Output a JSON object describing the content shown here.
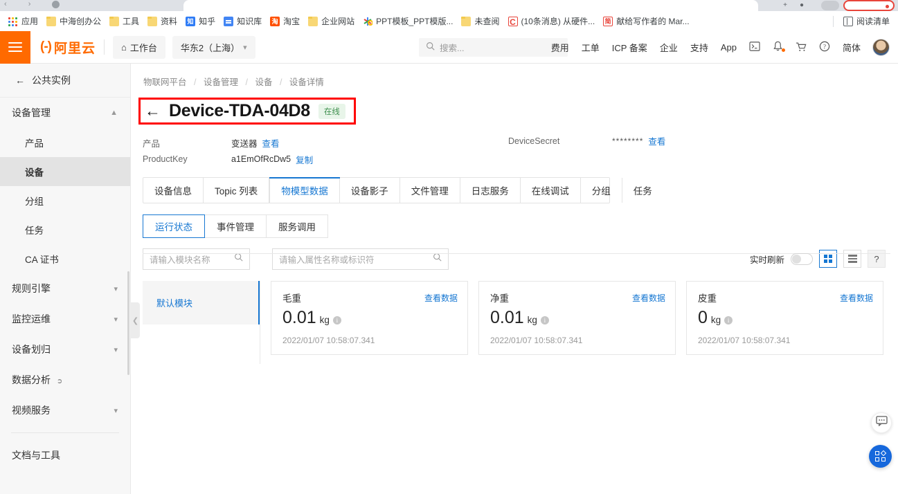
{
  "browser": {
    "bookmarks": [
      {
        "label": "应用",
        "icon": "apps-grid-icon"
      },
      {
        "label": "中海创办公",
        "icon": "folder-icon"
      },
      {
        "label": "工具",
        "icon": "folder-icon"
      },
      {
        "label": "资料",
        "icon": "folder-icon"
      },
      {
        "label": "知乎",
        "icon": "zhihu-icon"
      },
      {
        "label": "知识库",
        "icon": "doc-icon"
      },
      {
        "label": "淘宝",
        "icon": "taobao-icon"
      },
      {
        "label": "企业网站",
        "icon": "folder-icon"
      },
      {
        "label": "PPT模板_PPT模版...",
        "icon": "ppt-icon"
      },
      {
        "label": "未查阅",
        "icon": "folder-icon"
      },
      {
        "label": "(10条消息) 从硬件...",
        "icon": "csdn-icon"
      },
      {
        "label": "献给写作者的 Mar...",
        "icon": "jianshu-icon"
      }
    ],
    "reading_list": "阅读清单"
  },
  "header": {
    "logo_text": "阿里云",
    "workbench": "工作台",
    "region": "华东2（上海）",
    "search_placeholder": "搜索...",
    "nav": [
      "费用",
      "工单",
      "ICP 备案",
      "企业",
      "支持",
      "App"
    ],
    "lang": "简体",
    "icons": [
      "console-icon",
      "bell-icon",
      "cart-icon",
      "help-icon"
    ]
  },
  "sidebar": {
    "back_label": "公共实例",
    "groups": [
      {
        "label": "设备管理",
        "expanded": true,
        "items": [
          {
            "label": "产品",
            "active": false
          },
          {
            "label": "设备",
            "active": true
          },
          {
            "label": "分组",
            "active": false
          },
          {
            "label": "任务",
            "active": false
          },
          {
            "label": "CA 证书",
            "active": false
          }
        ]
      },
      {
        "label": "规则引擎",
        "expanded": false,
        "items": []
      },
      {
        "label": "监控运维",
        "expanded": false,
        "items": []
      },
      {
        "label": "设备划归",
        "expanded": false,
        "items": []
      },
      {
        "label": "数据分析",
        "expanded": false,
        "external": true,
        "items": []
      },
      {
        "label": "视频服务",
        "expanded": false,
        "items": []
      }
    ],
    "footer_link": "文档与工具"
  },
  "breadcrumb": [
    "物联网平台",
    "设备管理",
    "设备",
    "设备详情"
  ],
  "page": {
    "title": "Device-TDA-04D8",
    "status": "在线",
    "highlight_color": "#ff0000",
    "meta": {
      "product_key_label": "产品",
      "product_value": "变送器",
      "product_view": "查看",
      "productkey_label": "ProductKey",
      "productkey_value": "a1EmOfRcDw5",
      "productkey_copy": "复制",
      "secret_label": "DeviceSecret",
      "secret_value": "********",
      "secret_view": "查看"
    }
  },
  "tabs": [
    {
      "label": "设备信息",
      "active": false
    },
    {
      "label": "Topic 列表",
      "active": false
    },
    {
      "label": "物模型数据",
      "active": true
    },
    {
      "label": "设备影子",
      "active": false
    },
    {
      "label": "文件管理",
      "active": false
    },
    {
      "label": "日志服务",
      "active": false
    },
    {
      "label": "在线调试",
      "active": false
    },
    {
      "label": "分组",
      "active": false
    },
    {
      "label": "任务",
      "active": false
    }
  ],
  "subtabs": [
    {
      "label": "运行状态",
      "active": true
    },
    {
      "label": "事件管理",
      "active": false
    },
    {
      "label": "服务调用",
      "active": false
    }
  ],
  "filters": {
    "module_placeholder": "请输入模块名称",
    "property_placeholder": "请输入属性名称或标识符",
    "realtime_label": "实时刷新",
    "realtime_on": false,
    "view_grid_active": true,
    "help_label": "?"
  },
  "modules": [
    {
      "label": "默认模块",
      "active": true
    }
  ],
  "cards": [
    {
      "name": "毛重",
      "link": "查看数据",
      "value": "0.01",
      "unit": "kg",
      "time": "2022/01/07 10:58:07.341"
    },
    {
      "name": "净重",
      "link": "查看数据",
      "value": "0.01",
      "unit": "kg",
      "time": "2022/01/07 10:58:07.341"
    },
    {
      "name": "皮重",
      "link": "查看数据",
      "value": "0",
      "unit": "kg",
      "time": "2022/01/07 10:58:07.341"
    }
  ],
  "floating": {
    "chat_icon": "chat-bubble-icon",
    "apps_icon": "app-grid-icon"
  }
}
